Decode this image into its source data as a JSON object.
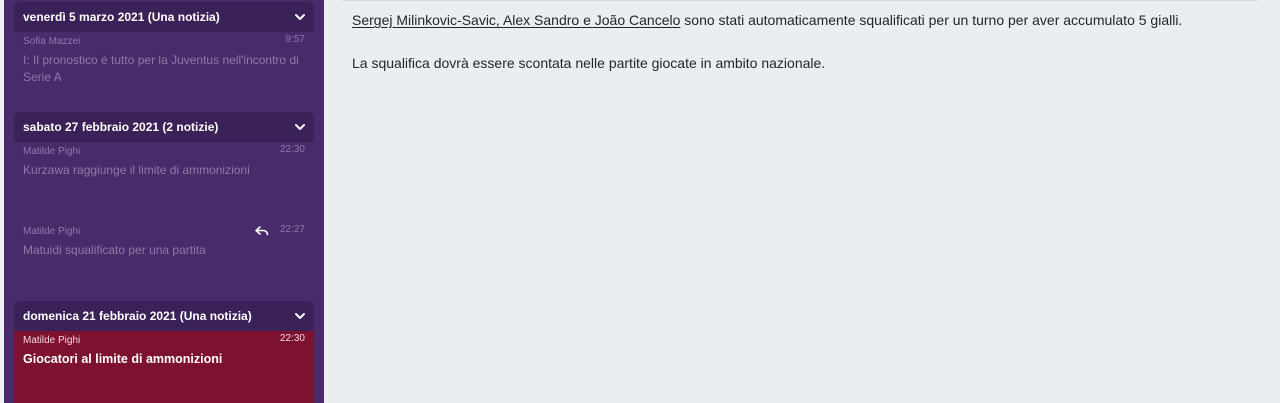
{
  "sidebar": {
    "groups": [
      {
        "header": "venerdì 5 marzo 2021 (Una notizia)",
        "messages": [
          {
            "sender": "Sofia Mazzei",
            "time": "9:57",
            "subject": "I: Il pronostico è tutto per la Juventus nell'incontro di Serie A"
          }
        ]
      },
      {
        "header": "sabato 27 febbraio 2021 (2 notizie)",
        "messages": [
          {
            "sender": "Matilde Pighi",
            "time": "22:30",
            "subject": "Kurzawa raggiunge il limite di ammonizioni"
          },
          {
            "sender": "Matilde Pighi",
            "time": "22:27",
            "subject": "Matuidi squalificato per una partita",
            "icon": "reply-icon"
          }
        ]
      },
      {
        "header": "domenica 21 febbraio 2021 (Una notizia)",
        "messages": [
          {
            "sender": "Matilde Pighi",
            "time": "22:30",
            "subject": "Giocatori al limite di ammonizioni",
            "selected": true
          }
        ]
      }
    ]
  },
  "article": {
    "p1_names": "Sergej Milinkovic-Savic, Alex Sandro e João Cancelo",
    "p1_rest": " sono stati automaticamente squalificati per un turno per aver accumulato 5 gialli.",
    "p2": "La squalifica dovrà essere scontata nelle partite giocate in ambito nazionale."
  },
  "colors": {
    "sidebar_bg": "#472b6a",
    "header_bg": "#3a2158",
    "selected_bg": "#7d1230",
    "content_bg": "#eaeef2"
  }
}
